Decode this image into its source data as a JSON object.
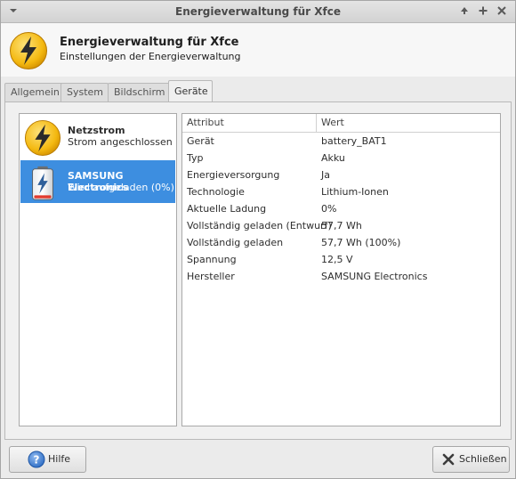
{
  "window": {
    "title": "Energieverwaltung für Xfce",
    "menu_icon": "chevron-down-icon",
    "controls": [
      "arrow-up-icon",
      "maximize-plus-icon",
      "close-x-icon"
    ]
  },
  "header": {
    "title": "Energieverwaltung für Xfce",
    "subtitle": "Einstellungen der Energieverwaltung",
    "icon": "lightning-bolt-icon"
  },
  "tabs": [
    {
      "label": "Allgemein",
      "active": false
    },
    {
      "label": "System",
      "active": false
    },
    {
      "label": "Bildschirm",
      "active": false
    },
    {
      "label": "Geräte",
      "active": true
    }
  ],
  "devices": [
    {
      "name": "Netzstrom",
      "status": "Strom angeschlossen",
      "icon": "ac-power-icon",
      "selected": false
    },
    {
      "name": "SAMSUNG Electronics",
      "status": "Wird aufgeladen (0%)",
      "icon": "battery-charging-icon",
      "selected": true
    }
  ],
  "properties": {
    "columns": [
      "Attribut",
      "Wert"
    ],
    "rows": [
      [
        "Gerät",
        "battery_BAT1"
      ],
      [
        "Typ",
        "Akku"
      ],
      [
        "Energieversorgung",
        "Ja"
      ],
      [
        "Technologie",
        "Lithium-Ionen"
      ],
      [
        "Aktuelle Ladung",
        "0%"
      ],
      [
        "Vollständig geladen (Entwurf)",
        "57,7 Wh"
      ],
      [
        "Vollständig geladen",
        "57,7 Wh (100%)"
      ],
      [
        "Spannung",
        "12,5 V"
      ],
      [
        "Hersteller",
        "SAMSUNG Electronics"
      ]
    ]
  },
  "footer": {
    "help_label": "Hilfe",
    "close_label": "Schließen"
  },
  "colors": {
    "accent": "#3d8ee0",
    "bolt_yellow": "#f5c518"
  }
}
